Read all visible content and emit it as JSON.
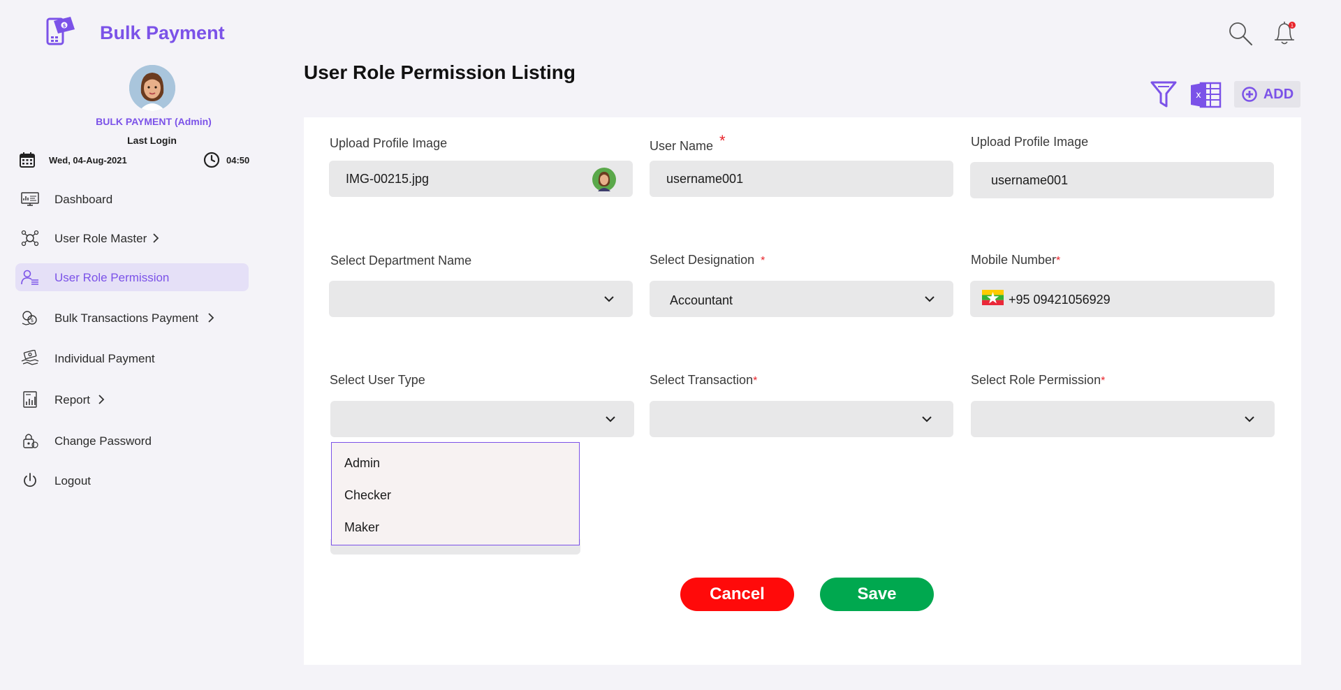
{
  "app": {
    "name": "Bulk Payment"
  },
  "profile": {
    "display_name": "BULK PAYMENT (Admin)",
    "last_login_label": "Last Login",
    "date": "Wed, 04-Aug-2021",
    "time": "04:50"
  },
  "sidebar": {
    "items": [
      {
        "label": "Dashboard",
        "icon": "dashboard-icon",
        "has_chevron": false,
        "active": false
      },
      {
        "label": "User Role Master",
        "icon": "role-network-icon",
        "has_chevron": true,
        "active": false
      },
      {
        "label": "User Role Permission",
        "icon": "user-list-icon",
        "has_chevron": false,
        "active": true
      },
      {
        "label": "Bulk Transactions Payment",
        "icon": "transactions-icon",
        "has_chevron": true,
        "active": false
      },
      {
        "label": "Individual Payment",
        "icon": "hand-money-icon",
        "has_chevron": false,
        "active": false
      },
      {
        "label": "Report",
        "icon": "report-icon",
        "has_chevron": true,
        "active": false
      },
      {
        "label": "Change Password",
        "icon": "lock-icon",
        "has_chevron": false,
        "active": false
      },
      {
        "label": "Logout",
        "icon": "power-icon",
        "has_chevron": false,
        "active": false
      }
    ]
  },
  "header": {
    "search_icon": "search-icon",
    "bell_icon": "bell-icon",
    "notification_count": "1"
  },
  "page": {
    "title": "User Role Permission Listing",
    "toolbar": {
      "add_label": "ADD"
    }
  },
  "form": {
    "upload_profile_image": {
      "label": "Upload Profile Image",
      "value": "IMG-00215.jpg"
    },
    "user_name": {
      "label": "User Name",
      "required_mark": "*",
      "value": "username001"
    },
    "upload_profile_image_2": {
      "label": "Upload Profile Image",
      "value": "username001"
    },
    "department": {
      "label": "Select Department Name",
      "value": ""
    },
    "designation": {
      "label": "Select Designation",
      "required_mark": "*",
      "value": "Accountant"
    },
    "mobile": {
      "label": "Mobile Number",
      "required_mark": "*",
      "value": "+95 09421056929"
    },
    "user_type": {
      "label": "Select User Type",
      "value": "",
      "options": [
        "Admin",
        "Checker",
        "Maker"
      ]
    },
    "transaction": {
      "label": "Select Transaction",
      "required_mark": "*",
      "value": ""
    },
    "role_permission": {
      "label": "Select Role Permission",
      "required_mark": "*",
      "value": ""
    },
    "cancel_label": "Cancel",
    "save_label": "Save"
  },
  "colors": {
    "brand": "#7b52e8",
    "active_bg": "#e5e0f7",
    "cancel": "#ff0a0a",
    "save": "#00a84f",
    "required": "#e8232a"
  }
}
